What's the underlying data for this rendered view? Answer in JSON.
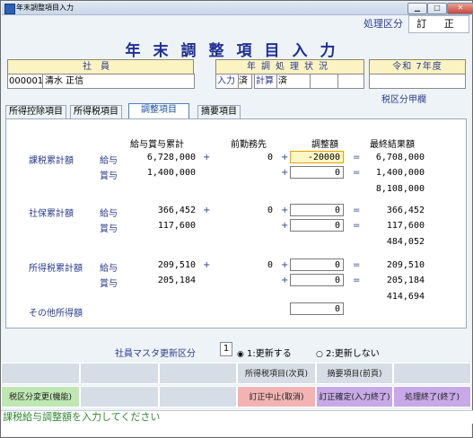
{
  "window": {
    "title": "年末調整項目入力"
  },
  "process": {
    "label": "処理区分",
    "value": "訂 正"
  },
  "main_title": "年末調整項目入力",
  "header": {
    "employee_label": "社員",
    "employee_code": "000001",
    "employee_name": "清水 正信",
    "status_label": "年調処理状況",
    "input_label": "入力",
    "input_value": "済",
    "calc_label": "計算",
    "calc_value": "済",
    "year_label": "令和 7年度",
    "tax_class": "税区分甲欄"
  },
  "tabs": [
    "所得控除項目",
    "所得税項目",
    "調整項目",
    "摘要項目"
  ],
  "active_tab": 2,
  "columns": {
    "salary_bonus": "給与賞与累計",
    "prev_employer": "前勤務先",
    "adjustment": "調整額",
    "final": "最終結果額"
  },
  "ops": {
    "plus": "+",
    "eq": "="
  },
  "sections": [
    {
      "label": "課税累計額",
      "rows": [
        {
          "type": "給与",
          "base": "6,728,000",
          "prev": "0",
          "adj": "-20000",
          "result": "6,708,000"
        },
        {
          "type": "賞与",
          "base": "1,400,000",
          "prev": "",
          "adj": "0",
          "result": "1,400,000"
        }
      ],
      "total": "8,108,000"
    },
    {
      "label": "社保累計額",
      "rows": [
        {
          "type": "給与",
          "base": "366,452",
          "prev": "0",
          "adj": "0",
          "result": "366,452"
        },
        {
          "type": "賞与",
          "base": "117,600",
          "prev": "",
          "adj": "0",
          "result": "117,600"
        }
      ],
      "total": "484,052"
    },
    {
      "label": "所得税累計額",
      "rows": [
        {
          "type": "給与",
          "base": "209,510",
          "prev": "0",
          "adj": "0",
          "result": "209,510"
        },
        {
          "type": "賞与",
          "base": "205,184",
          "prev": "",
          "adj": "0",
          "result": "205,184"
        }
      ],
      "total": "414,694"
    }
  ],
  "other_income": {
    "label": "その他所得額",
    "value": "0"
  },
  "master_update": {
    "label": "社員マスタ更新区分",
    "value": "1",
    "option1": "1:更新する",
    "option2": "2:更新しない"
  },
  "fkeys": {
    "row1": [
      "",
      "",
      "",
      "所得税項目(次頁)",
      "摘要項目(前頁)",
      ""
    ],
    "row2": [
      "税区分変更(機能)",
      "",
      "",
      "訂正中止(取消)",
      "訂正確定(入力終了)",
      "処理終了(終了)"
    ]
  },
  "fkey_colors": {
    "green": "#bfe7b3",
    "pink": "#f3b3b3",
    "purple": "#c6a9e6",
    "default": "#d7dde6"
  },
  "status_message": "課税給与調整額を入力してください"
}
